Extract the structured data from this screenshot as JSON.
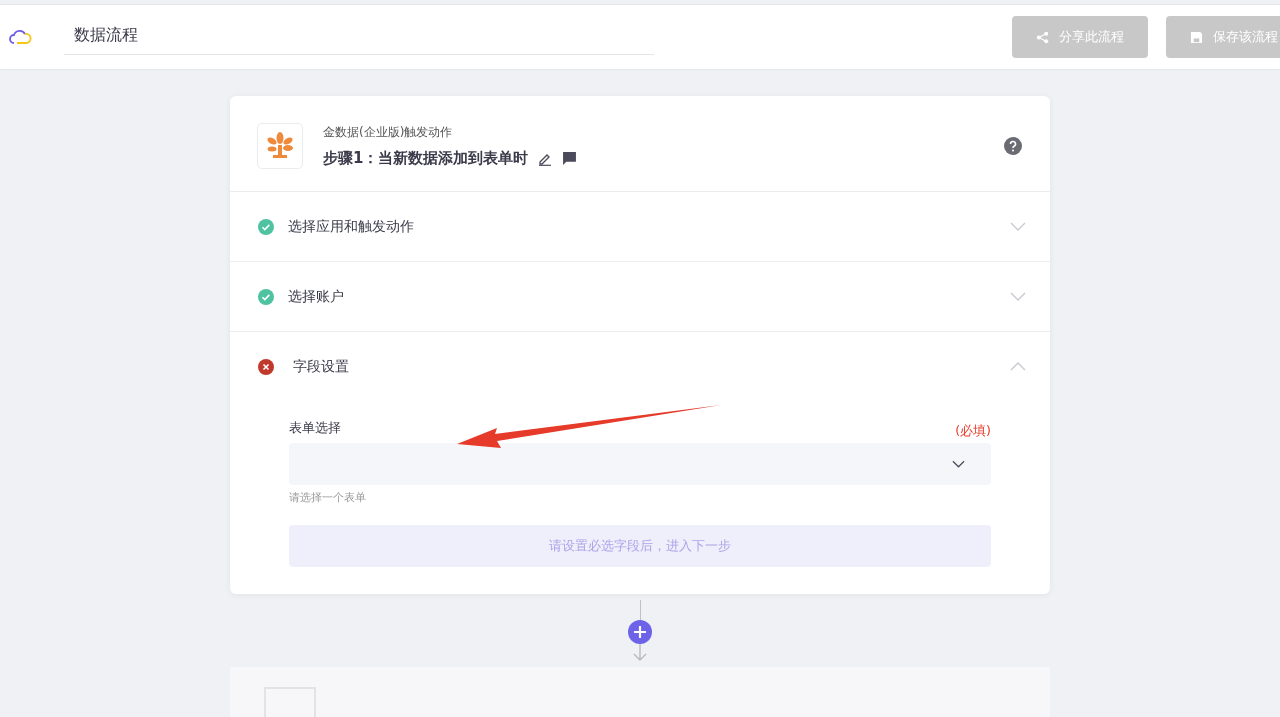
{
  "header": {
    "title": "数据流程",
    "buttons": [
      {
        "kind": "share",
        "label": "分享此流程",
        "disabled": true
      },
      {
        "kind": "save",
        "label": "保存该流程",
        "disabled": true
      }
    ]
  },
  "step1": {
    "app_name": "金数据(企业版)触发动作",
    "title": "步骤1：当新数据添加到表单时",
    "sections": [
      {
        "label": "选择应用和触发动作",
        "kind": "done",
        "expanded": false
      },
      {
        "label": "选择账户",
        "kind": "done",
        "expanded": false
      },
      {
        "label": "字段设置",
        "kind": "error",
        "expanded": true
      }
    ],
    "field": {
      "label": "表单选择",
      "required_note": "(必填)",
      "hint": "请选择一个表单"
    },
    "next_button": {
      "label": "请设置必选字段后，进入下一步",
      "disabled": true
    }
  }
}
